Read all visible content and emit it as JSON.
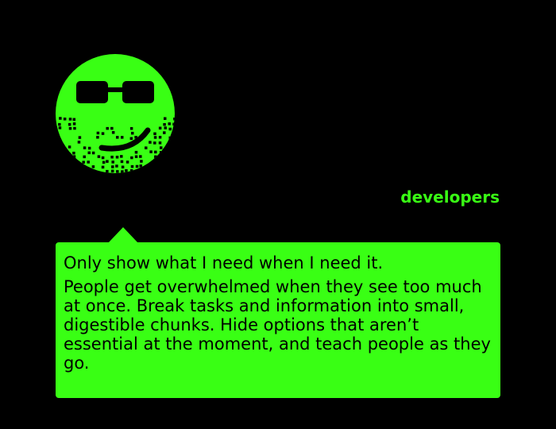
{
  "colors": {
    "background": "#000000",
    "accent": "#39ff14",
    "text_on_accent": "#000000"
  },
  "avatar": {
    "icon": "sunglasses-smiley-icon"
  },
  "tag": {
    "label": "developers"
  },
  "bubble": {
    "heading": "Only show what I need when I need it.",
    "body": "People get overwhelmed when they see too much at once. Break tasks and information into small, digestible chunks. Hide options that aren’t essential at the moment, and teach people as they go."
  }
}
